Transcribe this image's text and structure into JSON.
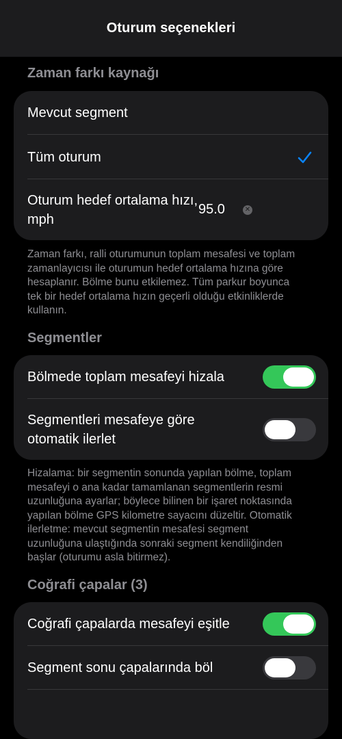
{
  "nav": {
    "title": "Oturum seçenekleri"
  },
  "colors": {
    "accent": "#0a84ff",
    "toggle_on": "#34c759",
    "toggle_off": "#39393d"
  },
  "time_offset_source": {
    "header": "Zaman farkı kaynağı",
    "rows": {
      "current_segment": "Mevcut segment",
      "whole_session": "Tüm oturum",
      "target_speed_label": "Oturum hedef ortalama hızı, mph",
      "target_speed_value": "95.0"
    },
    "selected": "whole_session",
    "footer": "Zaman farkı, ralli oturumunun toplam mesafesi ve toplam zamanlayıcısı ile oturumun hedef ortalama hızına göre hesaplanır. Bölme bunu etkilemez. Tüm parkur boyunca tek bir hedef ortalama hızın geçerli olduğu etkinliklerde kullanın."
  },
  "segments": {
    "header": "Segmentler",
    "rows": {
      "align_distance_on_split": {
        "label": "Bölmede toplam mesafeyi hizala",
        "on": true
      },
      "auto_advance": {
        "label": "Segmentleri mesafeye göre otomatik ilerlet",
        "on": false
      }
    },
    "footer": "Hizalama: bir segmentin sonunda yapılan bölme, toplam mesafeyi o ana kadar tamamlanan segmentlerin resmi uzunluğuna ayarlar; böylece bilinen bir işaret noktasında yapılan bölme GPS kilometre sayacını düzeltir. Otomatik ilerletme: mevcut segmentin mesafesi segment uzunluğuna ulaştığında sonraki segment kendiliğinden başlar (oturumu asla bitirmez)."
  },
  "geo_anchors": {
    "header": "Coğrafi çapalar (3)",
    "rows": {
      "equalize_distance": {
        "label": "Coğrafi çapalarda mesafeyi eşitle",
        "on": true
      },
      "split_at_end_anchors": {
        "label": "Segment sonu çapalarında böl",
        "on": false
      }
    }
  }
}
